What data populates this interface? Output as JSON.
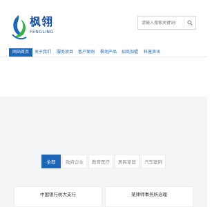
{
  "brand": {
    "name_cn": "枫翎",
    "name_en": "FENGLING",
    "colors": {
      "primary": "#1d66b8",
      "accent_green": "#35b44a"
    }
  },
  "search": {
    "placeholder": "请输入搜索关键词!",
    "icon": "search-icon"
  },
  "nav": {
    "items": [
      {
        "label": "网站首页",
        "active": true
      },
      {
        "label": "关于我们",
        "active": false
      },
      {
        "label": "服务项目",
        "active": false
      },
      {
        "label": "客户案例",
        "active": false
      },
      {
        "label": "枫翎产品",
        "active": false
      },
      {
        "label": "招商加盟",
        "active": false
      },
      {
        "label": "科普资讯",
        "active": false
      }
    ]
  },
  "cases": {
    "tabs": [
      {
        "label": "全部",
        "active": true
      },
      {
        "label": "政府企业",
        "active": false
      },
      {
        "label": "教育医疗",
        "active": false
      },
      {
        "label": "居民家庭",
        "active": false
      },
      {
        "label": "汽车案例",
        "active": false
      }
    ],
    "cards": [
      {
        "title": "中国银行杭大支行"
      },
      {
        "title": "某律师事务所治理"
      }
    ]
  }
}
